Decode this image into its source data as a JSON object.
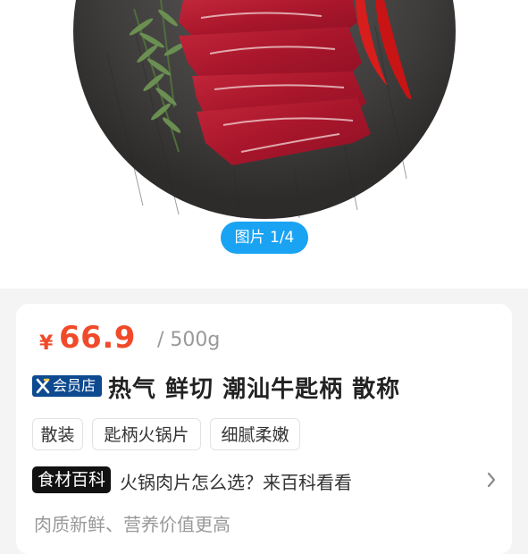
{
  "gallery": {
    "counter": "图片 1/4",
    "image": "sliced raw beef on dark round board with rosemary and red chili"
  },
  "product": {
    "currency": "¥",
    "price": "66.9",
    "unit": "/ 500g",
    "member_badge_label": "会员店",
    "title": "热气 鲜切 潮汕牛匙柄 散称",
    "tags": [
      "散装",
      "匙柄火锅片",
      "细腻柔嫩"
    ],
    "encyclopedia": {
      "logo_text": "食材百科",
      "text": "火锅肉片怎么选？来百科看看"
    },
    "description": "肉质新鲜、营养价值更高"
  },
  "colors": {
    "price": "#f04a2a",
    "counter_bg": "#1aa3f3",
    "member_badge_bg": "#0d4a8f"
  }
}
